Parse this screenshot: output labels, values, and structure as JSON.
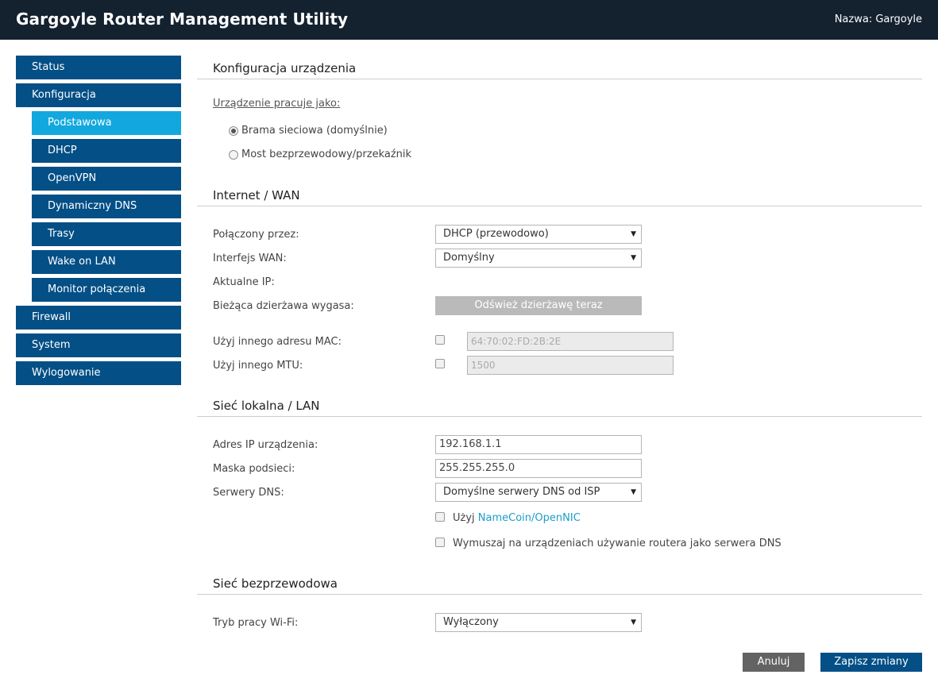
{
  "header": {
    "title": "Gargoyle Router Management Utility",
    "host_label": "Nazwa: Gargoyle"
  },
  "nav": {
    "items": [
      {
        "label": "Status"
      },
      {
        "label": "Konfiguracja"
      },
      {
        "label": "Podstawowa"
      },
      {
        "label": "DHCP"
      },
      {
        "label": "OpenVPN"
      },
      {
        "label": "Dynamiczny DNS"
      },
      {
        "label": "Trasy"
      },
      {
        "label": "Wake on LAN"
      },
      {
        "label": "Monitor połączenia"
      },
      {
        "label": "Firewall"
      },
      {
        "label": "System"
      },
      {
        "label": "Wylogowanie"
      }
    ],
    "active": "Podstawowa"
  },
  "device": {
    "title": "Konfiguracja urządzenia",
    "mode_label": "Urządzenie pracuje jako:",
    "option_gateway": "Brama sieciowa (domyślnie)",
    "option_bridge": "Most bezprzewodowy/przekaźnik",
    "selected": "gateway"
  },
  "wan": {
    "title": "Internet / WAN",
    "connected_via_label": "Połączony przez:",
    "connected_via_value": "DHCP (przewodowo)",
    "interface_label": "Interfejs WAN:",
    "interface_value": "Domyślny",
    "current_ip_label": "Aktualne IP:",
    "lease_label": "Bieżąca dzierżawa wygasa:",
    "renew_button": "Odśwież dzierżawę teraz",
    "mac_label": "Użyj innego adresu MAC:",
    "mac_value": "64:70:02:FD:2B:2E",
    "mtu_label": "Użyj innego MTU:",
    "mtu_value": "1500"
  },
  "lan": {
    "title": "Sieć lokalna / LAN",
    "ip_label": "Adres IP urządzenia:",
    "ip_value": "192.168.1.1",
    "mask_label": "Maska podsieci:",
    "mask_value": "255.255.255.0",
    "dns_label": "Serwery DNS:",
    "dns_value": "Domyślne serwery DNS od ISP",
    "namecoin_prefix": "Użyj",
    "namecoin_link": "NameCoin/OpenNIC",
    "force_dns": "Wymuszaj na urządzeniach używanie routera jako serwera DNS"
  },
  "wifi": {
    "title": "Sieć bezprzewodowa",
    "mode_label": "Tryb pracy Wi-Fi:",
    "mode_value": "Wyłączony"
  },
  "actions": {
    "cancel": "Anuluj",
    "save": "Zapisz zmiany"
  },
  "colors": {
    "topbar": "#14212f",
    "nav": "#034f86",
    "nav_active": "#13a8dd",
    "link": "#1a9ec9"
  }
}
